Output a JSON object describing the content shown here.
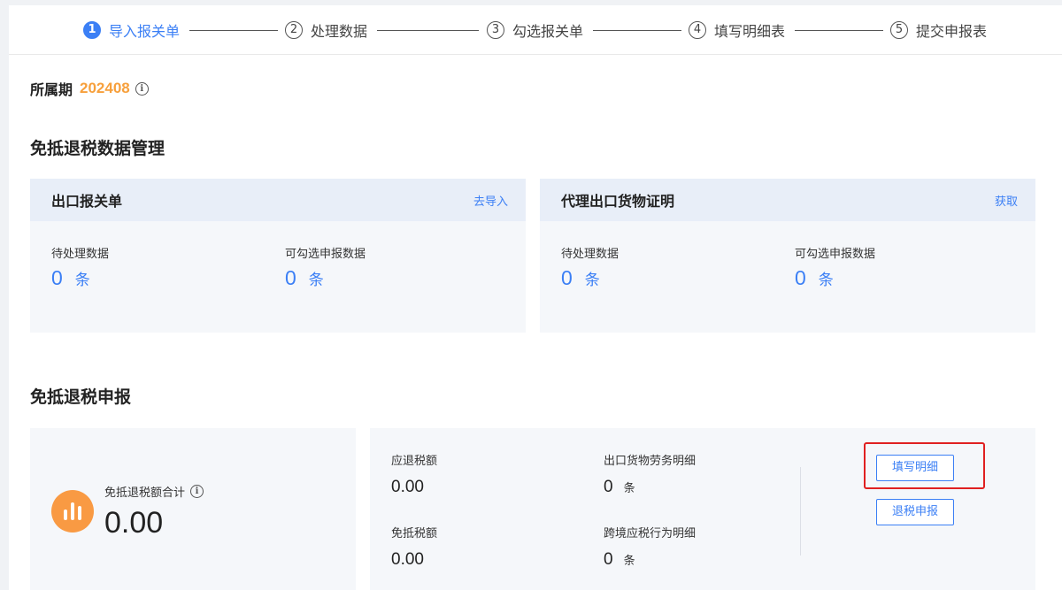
{
  "stepper": {
    "steps": [
      {
        "num": "1",
        "label": "导入报关单"
      },
      {
        "num": "2",
        "label": "处理数据"
      },
      {
        "num": "3",
        "label": "勾选报关单"
      },
      {
        "num": "4",
        "label": "填写明细表"
      },
      {
        "num": "5",
        "label": "提交申报表"
      }
    ],
    "active_step": 1
  },
  "period": {
    "label": "所属期",
    "value": "202408",
    "info_icon": "info-icon"
  },
  "data_management": {
    "title": "免抵退税数据管理",
    "cards": [
      {
        "title": "出口报关单",
        "action": "去导入",
        "metrics": [
          {
            "label": "待处理数据",
            "value": "0",
            "unit": "条"
          },
          {
            "label": "可勾选申报数据",
            "value": "0",
            "unit": "条"
          }
        ]
      },
      {
        "title": "代理出口货物证明",
        "action": "获取",
        "metrics": [
          {
            "label": "待处理数据",
            "value": "0",
            "unit": "条"
          },
          {
            "label": "可勾选申报数据",
            "value": "0",
            "unit": "条"
          }
        ]
      }
    ]
  },
  "declaration": {
    "title": "免抵退税申报",
    "total": {
      "label": "免抵退税额合计",
      "value": "0.00",
      "icon": "bar-chart-icon"
    },
    "details": {
      "refund_label": "应退税额",
      "refund_value": "0.00",
      "offset_label": "免抵税额",
      "offset_value": "0.00",
      "goods_label": "出口货物劳务明细",
      "goods_value": "0",
      "goods_unit": "条",
      "cross_label": "跨境应税行为明细",
      "cross_value": "0",
      "cross_unit": "条"
    },
    "buttons": {
      "fill_detail": "填写明细",
      "refund_declare": "退税申报"
    }
  },
  "colors": {
    "accent": "#3b7ff5",
    "period": "#f7a03c",
    "highlight": "#e02020",
    "icon_bg": "#f99a43"
  }
}
